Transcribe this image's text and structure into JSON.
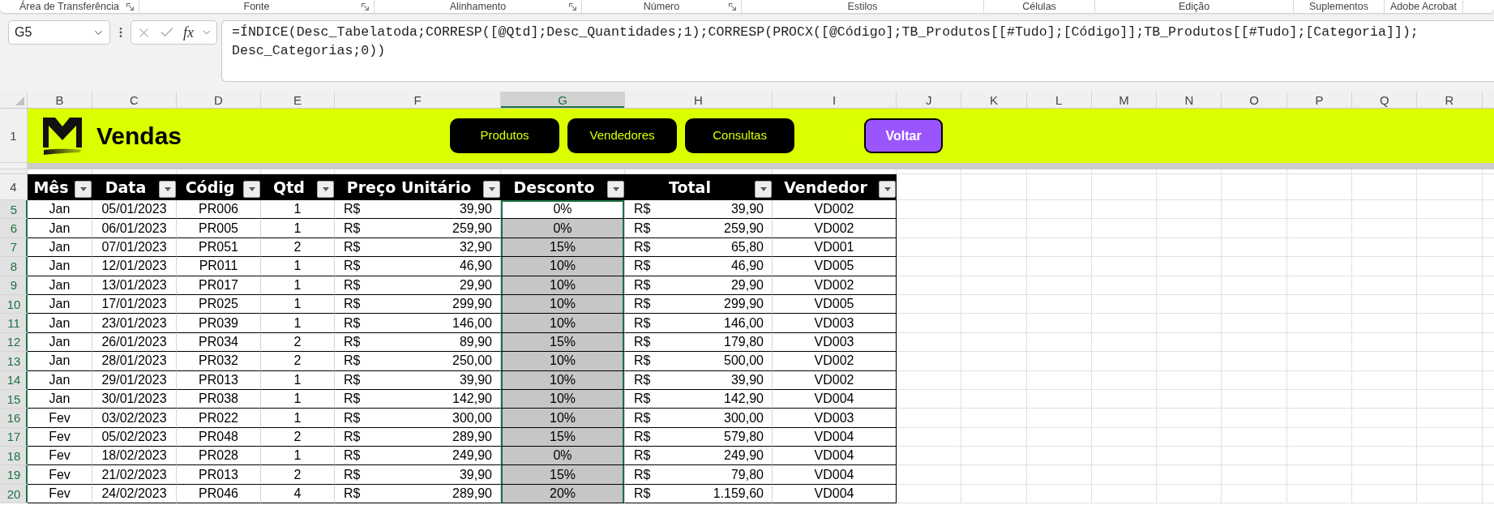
{
  "ribbon_groups": [
    {
      "label": "Área de Transferência",
      "has_launcher": true
    },
    {
      "label": "Fonte",
      "has_launcher": true
    },
    {
      "label": "Alinhamento",
      "has_launcher": true
    },
    {
      "label": "Número",
      "has_launcher": true
    },
    {
      "label": "Estilos",
      "has_launcher": false
    },
    {
      "label": "Células",
      "has_launcher": false
    },
    {
      "label": "Edição",
      "has_launcher": false
    },
    {
      "label": "Suplementos",
      "has_launcher": false
    },
    {
      "label": "Adobe Acrobat",
      "has_launcher": false
    }
  ],
  "formula_bar": {
    "name_box": "G5",
    "function_button": "fx",
    "formula": "=ÍNDICE(Desc_Tabelatoda;CORRESP([@Qtd];Desc_Quantidades;1);CORRESP(PROCX([@Código];TB_Produtos[[#Tudo];[Código]];TB_Produtos[[#Tudo];[Categoria]]);Desc_Categorias;0))"
  },
  "sheet": {
    "columns": [
      {
        "letter": "B",
        "selected": false
      },
      {
        "letter": "C",
        "selected": false
      },
      {
        "letter": "D",
        "selected": false
      },
      {
        "letter": "E",
        "selected": false
      },
      {
        "letter": "F",
        "selected": false
      },
      {
        "letter": "G",
        "selected": true
      },
      {
        "letter": "H",
        "selected": false
      },
      {
        "letter": "I",
        "selected": false
      },
      {
        "letter": "J",
        "selected": false
      },
      {
        "letter": "K",
        "selected": false
      },
      {
        "letter": "L",
        "selected": false
      },
      {
        "letter": "M",
        "selected": false
      },
      {
        "letter": "N",
        "selected": false
      },
      {
        "letter": "O",
        "selected": false
      },
      {
        "letter": "P",
        "selected": false
      },
      {
        "letter": "Q",
        "selected": false
      },
      {
        "letter": "R",
        "selected": false
      }
    ],
    "banner": {
      "row_number": "1",
      "title": "Vendas",
      "buttons": [
        {
          "label": "Produtos",
          "kind": "nav"
        },
        {
          "label": "Vendedores",
          "kind": "nav"
        },
        {
          "label": "Consultas",
          "kind": "nav"
        },
        {
          "label": "Voltar",
          "kind": "back"
        }
      ]
    },
    "table": {
      "header_row_number": "4",
      "headers": [
        "Mês",
        "Data",
        "Códig",
        "Qtd",
        "Preço Unitário",
        "Desconto",
        "Total",
        "Vendedor"
      ],
      "rows": [
        {
          "row_number": "5",
          "selected": true,
          "active": true,
          "mes": "Jan",
          "data": "05/01/2023",
          "codigo": "PR006",
          "qtd": "1",
          "preco_unitario": {
            "currency": "R$",
            "amount": "39,90"
          },
          "desconto": "0%",
          "total": {
            "currency": "R$",
            "amount": "39,90"
          },
          "vendedor": "VD002"
        },
        {
          "row_number": "6",
          "selected": true,
          "active": false,
          "mes": "Jan",
          "data": "06/01/2023",
          "codigo": "PR005",
          "qtd": "1",
          "preco_unitario": {
            "currency": "R$",
            "amount": "259,90"
          },
          "desconto": "0%",
          "total": {
            "currency": "R$",
            "amount": "259,90"
          },
          "vendedor": "VD002"
        },
        {
          "row_number": "7",
          "selected": true,
          "active": false,
          "mes": "Jan",
          "data": "07/01/2023",
          "codigo": "PR051",
          "qtd": "2",
          "preco_unitario": {
            "currency": "R$",
            "amount": "32,90"
          },
          "desconto": "15%",
          "total": {
            "currency": "R$",
            "amount": "65,80"
          },
          "vendedor": "VD001"
        },
        {
          "row_number": "8",
          "selected": true,
          "active": false,
          "mes": "Jan",
          "data": "12/01/2023",
          "codigo": "PR011",
          "qtd": "1",
          "preco_unitario": {
            "currency": "R$",
            "amount": "46,90"
          },
          "desconto": "10%",
          "total": {
            "currency": "R$",
            "amount": "46,90"
          },
          "vendedor": "VD005"
        },
        {
          "row_number": "9",
          "selected": true,
          "active": false,
          "mes": "Jan",
          "data": "13/01/2023",
          "codigo": "PR017",
          "qtd": "1",
          "preco_unitario": {
            "currency": "R$",
            "amount": "29,90"
          },
          "desconto": "10%",
          "total": {
            "currency": "R$",
            "amount": "29,90"
          },
          "vendedor": "VD002"
        },
        {
          "row_number": "10",
          "selected": true,
          "active": false,
          "mes": "Jan",
          "data": "17/01/2023",
          "codigo": "PR025",
          "qtd": "1",
          "preco_unitario": {
            "currency": "R$",
            "amount": "299,90"
          },
          "desconto": "10%",
          "total": {
            "currency": "R$",
            "amount": "299,90"
          },
          "vendedor": "VD005"
        },
        {
          "row_number": "11",
          "selected": true,
          "active": false,
          "mes": "Jan",
          "data": "23/01/2023",
          "codigo": "PR039",
          "qtd": "1",
          "preco_unitario": {
            "currency": "R$",
            "amount": "146,00"
          },
          "desconto": "10%",
          "total": {
            "currency": "R$",
            "amount": "146,00"
          },
          "vendedor": "VD003"
        },
        {
          "row_number": "12",
          "selected": true,
          "active": false,
          "mes": "Jan",
          "data": "26/01/2023",
          "codigo": "PR034",
          "qtd": "2",
          "preco_unitario": {
            "currency": "R$",
            "amount": "89,90"
          },
          "desconto": "15%",
          "total": {
            "currency": "R$",
            "amount": "179,80"
          },
          "vendedor": "VD003"
        },
        {
          "row_number": "13",
          "selected": true,
          "active": false,
          "mes": "Jan",
          "data": "28/01/2023",
          "codigo": "PR032",
          "qtd": "2",
          "preco_unitario": {
            "currency": "R$",
            "amount": "250,00"
          },
          "desconto": "10%",
          "total": {
            "currency": "R$",
            "amount": "500,00"
          },
          "vendedor": "VD002"
        },
        {
          "row_number": "14",
          "selected": true,
          "active": false,
          "mes": "Jan",
          "data": "29/01/2023",
          "codigo": "PR013",
          "qtd": "1",
          "preco_unitario": {
            "currency": "R$",
            "amount": "39,90"
          },
          "desconto": "10%",
          "total": {
            "currency": "R$",
            "amount": "39,90"
          },
          "vendedor": "VD002"
        },
        {
          "row_number": "15",
          "selected": true,
          "active": false,
          "mes": "Jan",
          "data": "30/01/2023",
          "codigo": "PR038",
          "qtd": "1",
          "preco_unitario": {
            "currency": "R$",
            "amount": "142,90"
          },
          "desconto": "10%",
          "total": {
            "currency": "R$",
            "amount": "142,90"
          },
          "vendedor": "VD004"
        },
        {
          "row_number": "16",
          "selected": true,
          "active": false,
          "mes": "Fev",
          "data": "03/02/2023",
          "codigo": "PR022",
          "qtd": "1",
          "preco_unitario": {
            "currency": "R$",
            "amount": "300,00"
          },
          "desconto": "10%",
          "total": {
            "currency": "R$",
            "amount": "300,00"
          },
          "vendedor": "VD003"
        },
        {
          "row_number": "17",
          "selected": true,
          "active": false,
          "mes": "Fev",
          "data": "05/02/2023",
          "codigo": "PR048",
          "qtd": "2",
          "preco_unitario": {
            "currency": "R$",
            "amount": "289,90"
          },
          "desconto": "15%",
          "total": {
            "currency": "R$",
            "amount": "579,80"
          },
          "vendedor": "VD004"
        },
        {
          "row_number": "18",
          "selected": true,
          "active": false,
          "mes": "Fev",
          "data": "18/02/2023",
          "codigo": "PR028",
          "qtd": "1",
          "preco_unitario": {
            "currency": "R$",
            "amount": "249,90"
          },
          "desconto": "0%",
          "total": {
            "currency": "R$",
            "amount": "249,90"
          },
          "vendedor": "VD004"
        },
        {
          "row_number": "19",
          "selected": true,
          "active": false,
          "mes": "Fev",
          "data": "21/02/2023",
          "codigo": "PR013",
          "qtd": "2",
          "preco_unitario": {
            "currency": "R$",
            "amount": "39,90"
          },
          "desconto": "15%",
          "total": {
            "currency": "R$",
            "amount": "79,80"
          },
          "vendedor": "VD004"
        },
        {
          "row_number": "20",
          "selected": true,
          "active": false,
          "mes": "Fev",
          "data": "24/02/2023",
          "codigo": "PR046",
          "qtd": "4",
          "preco_unitario": {
            "currency": "R$",
            "amount": "289,90"
          },
          "desconto": "20%",
          "total": {
            "currency": "R$",
            "amount": "1.159,60"
          },
          "vendedor": "VD004"
        }
      ]
    }
  }
}
